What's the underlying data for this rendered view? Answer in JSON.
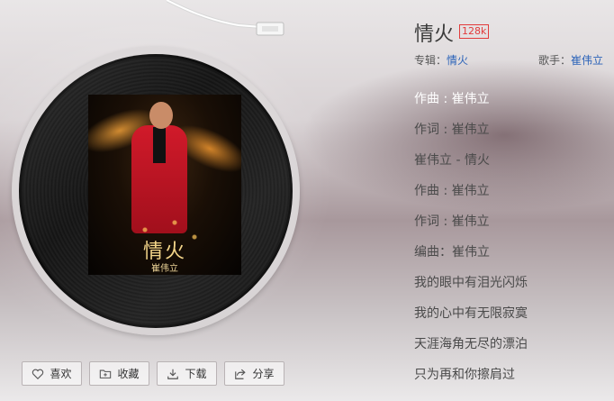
{
  "song": {
    "title": "情火",
    "quality": "128k",
    "album_label": "专辑：",
    "album": "情火",
    "artist_label": "歌手：",
    "artist": "崔伟立"
  },
  "cover": {
    "title": "情火",
    "artist": "崔伟立"
  },
  "lyrics": [
    "作曲 : 崔伟立",
    "作词 : 崔伟立",
    "崔伟立 - 情火",
    "作曲 : 崔伟立",
    "作词 : 崔伟立",
    "编曲：崔伟立",
    "我的眼中有泪光闪烁",
    "我的心中有无限寂寞",
    "天涯海角无尽的漂泊",
    "只为再和你擦肩过"
  ],
  "actions": {
    "like": {
      "label": "喜欢",
      "icon": "heart-icon"
    },
    "collect": {
      "label": "收藏",
      "icon": "add-folder-icon"
    },
    "download": {
      "label": "下载",
      "icon": "download-icon"
    },
    "share": {
      "label": "分享",
      "icon": "share-icon"
    }
  }
}
